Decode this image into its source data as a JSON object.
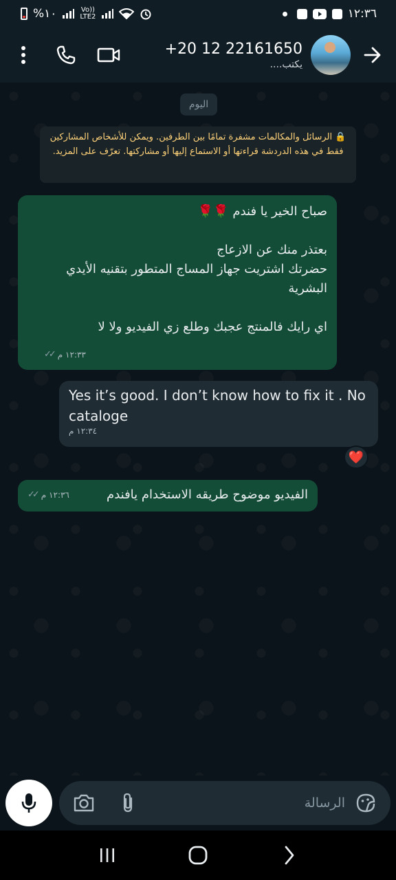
{
  "status_bar": {
    "time": "١٢:٣٦",
    "battery": "%١٠",
    "network_label_top": "Vo))",
    "network_label_bottom": "LTE2",
    "icons": [
      "battery-icon",
      "signal-icon",
      "volte-icon",
      "signal2-icon",
      "wifi-icon",
      "alarm-icon",
      "dot-icon",
      "facebook-icon",
      "youtube-icon",
      "gallery-icon"
    ]
  },
  "header": {
    "contact_name": "+20 12 22161650",
    "contact_status": "يكتب....",
    "icons": [
      "more-vert-icon",
      "phone-icon",
      "video-icon",
      "back-arrow-icon"
    ]
  },
  "chat": {
    "date_chip": "اليوم",
    "encryption_notice": "🔒 الرسائل والمكالمات مشفرة تمامًا بين الطرفين. ويمكن للأشخاص المشاركين فقط في هذه الدردشة قراءتها أو الاستماع إليها أو مشاركتها. تعرّف على المزيد.",
    "messages": [
      {
        "direction": "outgoing",
        "lines": [
          "صباح الخير يا فندم 🌹🌹",
          "",
          "بعتذر منك عن الازعاج",
          "حضرتك اشتريت جهاز المساج المتطور بتقنيه الأيدي البشرية",
          "",
          "اي رايك فالمنتج عجبك وطلع زي الفيديو ولا لا"
        ],
        "time": "١٢:٣٣ م",
        "status": "read"
      },
      {
        "direction": "incoming",
        "text": "Yes it’s good. I don’t know how to fix it . No cataloge",
        "time": "١٢:٣٤ م",
        "reaction": "❤️"
      },
      {
        "direction": "outgoing",
        "text": "الفيديو موضوح طريقه الاستخدام يافندم",
        "time": "١٢:٣٦ م",
        "status": "read"
      }
    ]
  },
  "composer": {
    "placeholder": "الرسالة",
    "icons": [
      "mic-icon",
      "camera-icon",
      "attach-icon",
      "sticker-icon"
    ]
  },
  "nav": {
    "icons": [
      "recents-icon",
      "home-icon",
      "back-icon"
    ]
  }
}
